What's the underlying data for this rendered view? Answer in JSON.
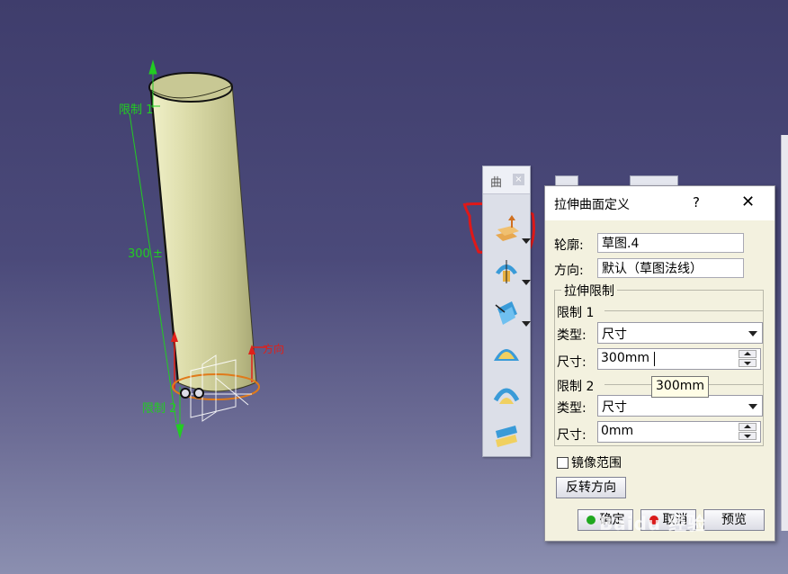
{
  "viewport": {
    "dimension_label": "300",
    "limit1_label": "限制 1",
    "limit2_label": "限制 2",
    "direction_label": "方向"
  },
  "toolbar": {
    "title": "曲",
    "close_glyph": "×",
    "buttons": [
      {
        "icon": "extrude-surface-icon",
        "has_dropdown": true
      },
      {
        "icon": "revolve-surface-icon",
        "has_dropdown": true
      },
      {
        "icon": "offset-surface-icon",
        "has_dropdown": true
      },
      {
        "icon": "sweep-surface-icon",
        "has_dropdown": false
      },
      {
        "icon": "fill-surface-icon",
        "has_dropdown": false
      },
      {
        "icon": "blend-surface-icon",
        "has_dropdown": false
      }
    ]
  },
  "dialog": {
    "title": "拉伸曲面定义",
    "help": "?",
    "close": "✕",
    "profile_label": "轮廓:",
    "profile_value": "草图.4",
    "direction_label": "方向:",
    "direction_value": "默认（草图法线）",
    "extrude_limits_label": "拉伸限制",
    "limit1": {
      "label": "限制 1",
      "type_label": "类型:",
      "type_value": "尺寸",
      "size_label": "尺寸:",
      "size_value": "300mm"
    },
    "limit2": {
      "label": "限制 2",
      "type_label": "类型:",
      "type_value": "尺寸",
      "size_label": "尺寸:",
      "size_value": "0mm"
    },
    "mirror_label": "镜像范围",
    "reverse_button": "反转方向",
    "ok_button": "确定",
    "cancel_button": "取消",
    "preview_button": "预览"
  },
  "tooltip": "300mm",
  "watermark": "Baidu 经验",
  "colors": {
    "background_top": "#3f3d6c",
    "cylinder": "#d9d9a8",
    "dimension": "#22cc22",
    "annotation_red": "#e0201a",
    "ok_led": "#1fa81f",
    "cancel_led": "#d91b1b"
  }
}
